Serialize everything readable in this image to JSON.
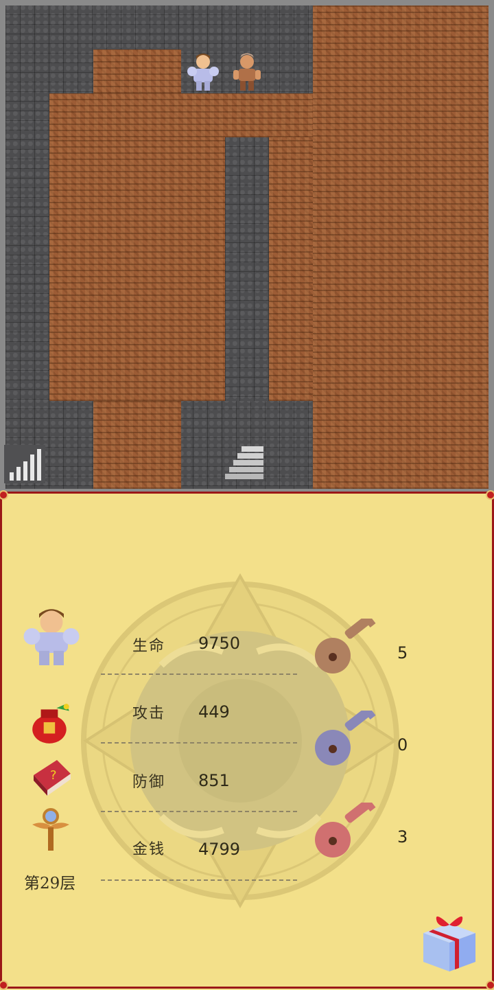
{
  "map": {
    "walls_color": "#4d4d4f",
    "floor_color": "#9c5c35",
    "icons": {
      "signal": "signal-strength-icon",
      "stairs": "stairs-up-icon"
    },
    "characters": [
      "armored-hero-icon",
      "thief-npc-icon"
    ]
  },
  "panel": {
    "background": "#f3e08a",
    "border_color": "#9a1818",
    "stats": [
      {
        "label": "生命",
        "value": "9750"
      },
      {
        "label": "攻击",
        "value": "449"
      },
      {
        "label": "防御",
        "value": "851"
      },
      {
        "label": "金钱",
        "value": "4799"
      }
    ],
    "keys": [
      {
        "name": "yellow-key-icon",
        "color": "#b08060",
        "count": "5"
      },
      {
        "name": "blue-key-icon",
        "color": "#8a88b8",
        "count": "0"
      },
      {
        "name": "red-key-icon",
        "color": "#d07070",
        "count": "3"
      }
    ],
    "items": [
      "lucky-bag-icon",
      "monster-book-icon",
      "floor-fly-wand-icon",
      "gift-box-icon"
    ],
    "floor": "第29层"
  }
}
